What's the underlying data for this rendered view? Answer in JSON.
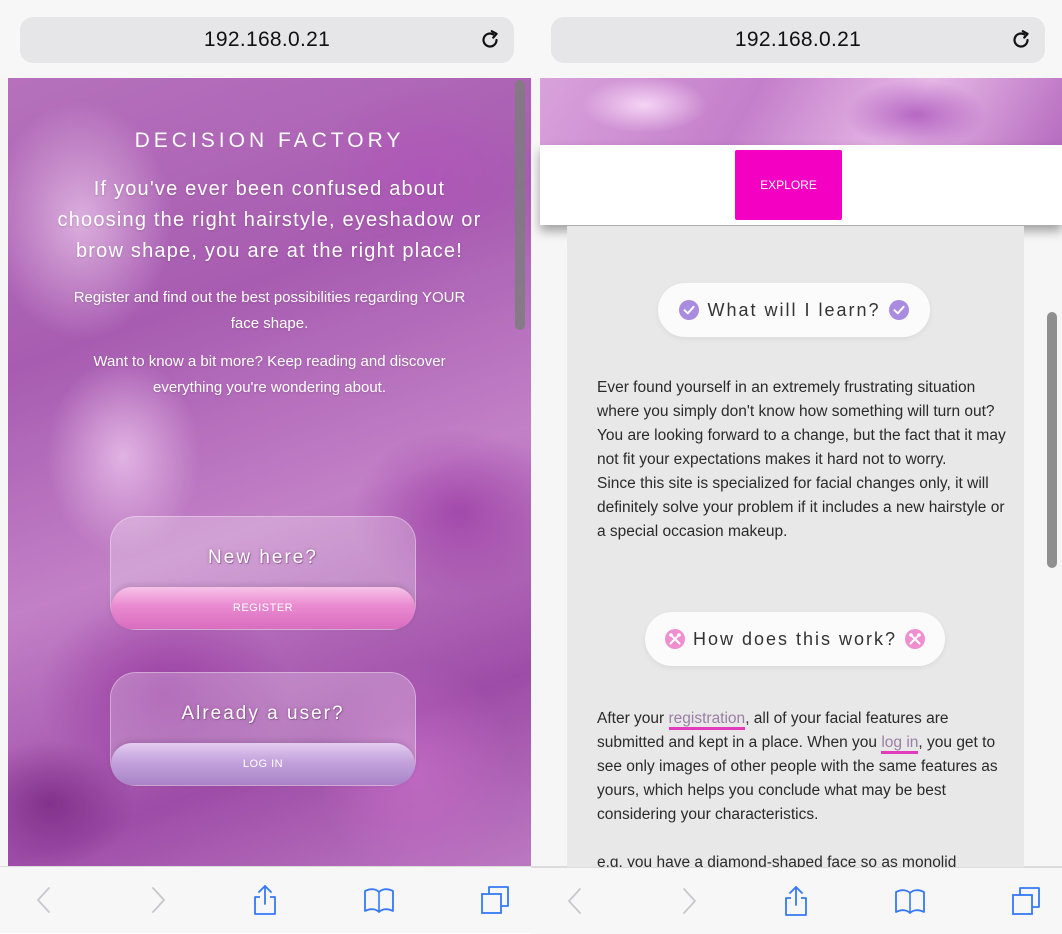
{
  "left": {
    "address": "192.168.0.21",
    "brand": "DECISION FACTORY",
    "headline": "If you've ever been confused about choosing the right hairstyle, eyeshadow or brow shape, you are at the right place!",
    "paragraph1": "Register and find out the best possibilities regarding YOUR face shape.",
    "paragraph2": "Want to know a bit more? Keep reading and discover everything you're wondering about.",
    "new_card": {
      "title": "New here?",
      "button": "REGISTER"
    },
    "user_card": {
      "title": "Already a user?",
      "button": "LOG IN"
    }
  },
  "right": {
    "address": "192.168.0.21",
    "explore_button": "EXPLORE",
    "learn_pill": "What will I learn?",
    "learn_text": "Ever found yourself in an extremely frustrating situation where you simply don't know how something will turn out? You are looking forward to a change, but the fact that it may not fit your expectations makes it hard not to worry.",
    "learn_text2": "Since this site is specialized for facial changes only, it will definitely solve your problem if it includes a new hairstyle or a special occasion makeup.",
    "work_pill": "How does this work?",
    "work_text": {
      "before": "After your ",
      "link1": "registration",
      "middle": ", all of your facial features are submitted and kept in a place. When you ",
      "link2": "log in",
      "after": ", you get to see only images of other people with the same features as yours, which helps you conclude what may be best considering your characteristics."
    },
    "eg_text": "e.g. you have a diamond-shaped face so as monolid"
  },
  "icons": {
    "reload": "reload-icon",
    "back": "back-chevron-icon",
    "forward": "forward-chevron-icon",
    "share": "share-icon",
    "bookmarks": "book-icon",
    "tabs": "tabs-icon",
    "check": "check-circle-icon",
    "tools": "tools-circle-icon"
  },
  "colors": {
    "accent_magenta": "#f400c3",
    "link_underline": "#e23cbc",
    "register_pink": "#e98ad0",
    "login_lilac": "#c3a2dc",
    "check_purple": "#a98be0",
    "tools_pink": "#f08fd0"
  }
}
